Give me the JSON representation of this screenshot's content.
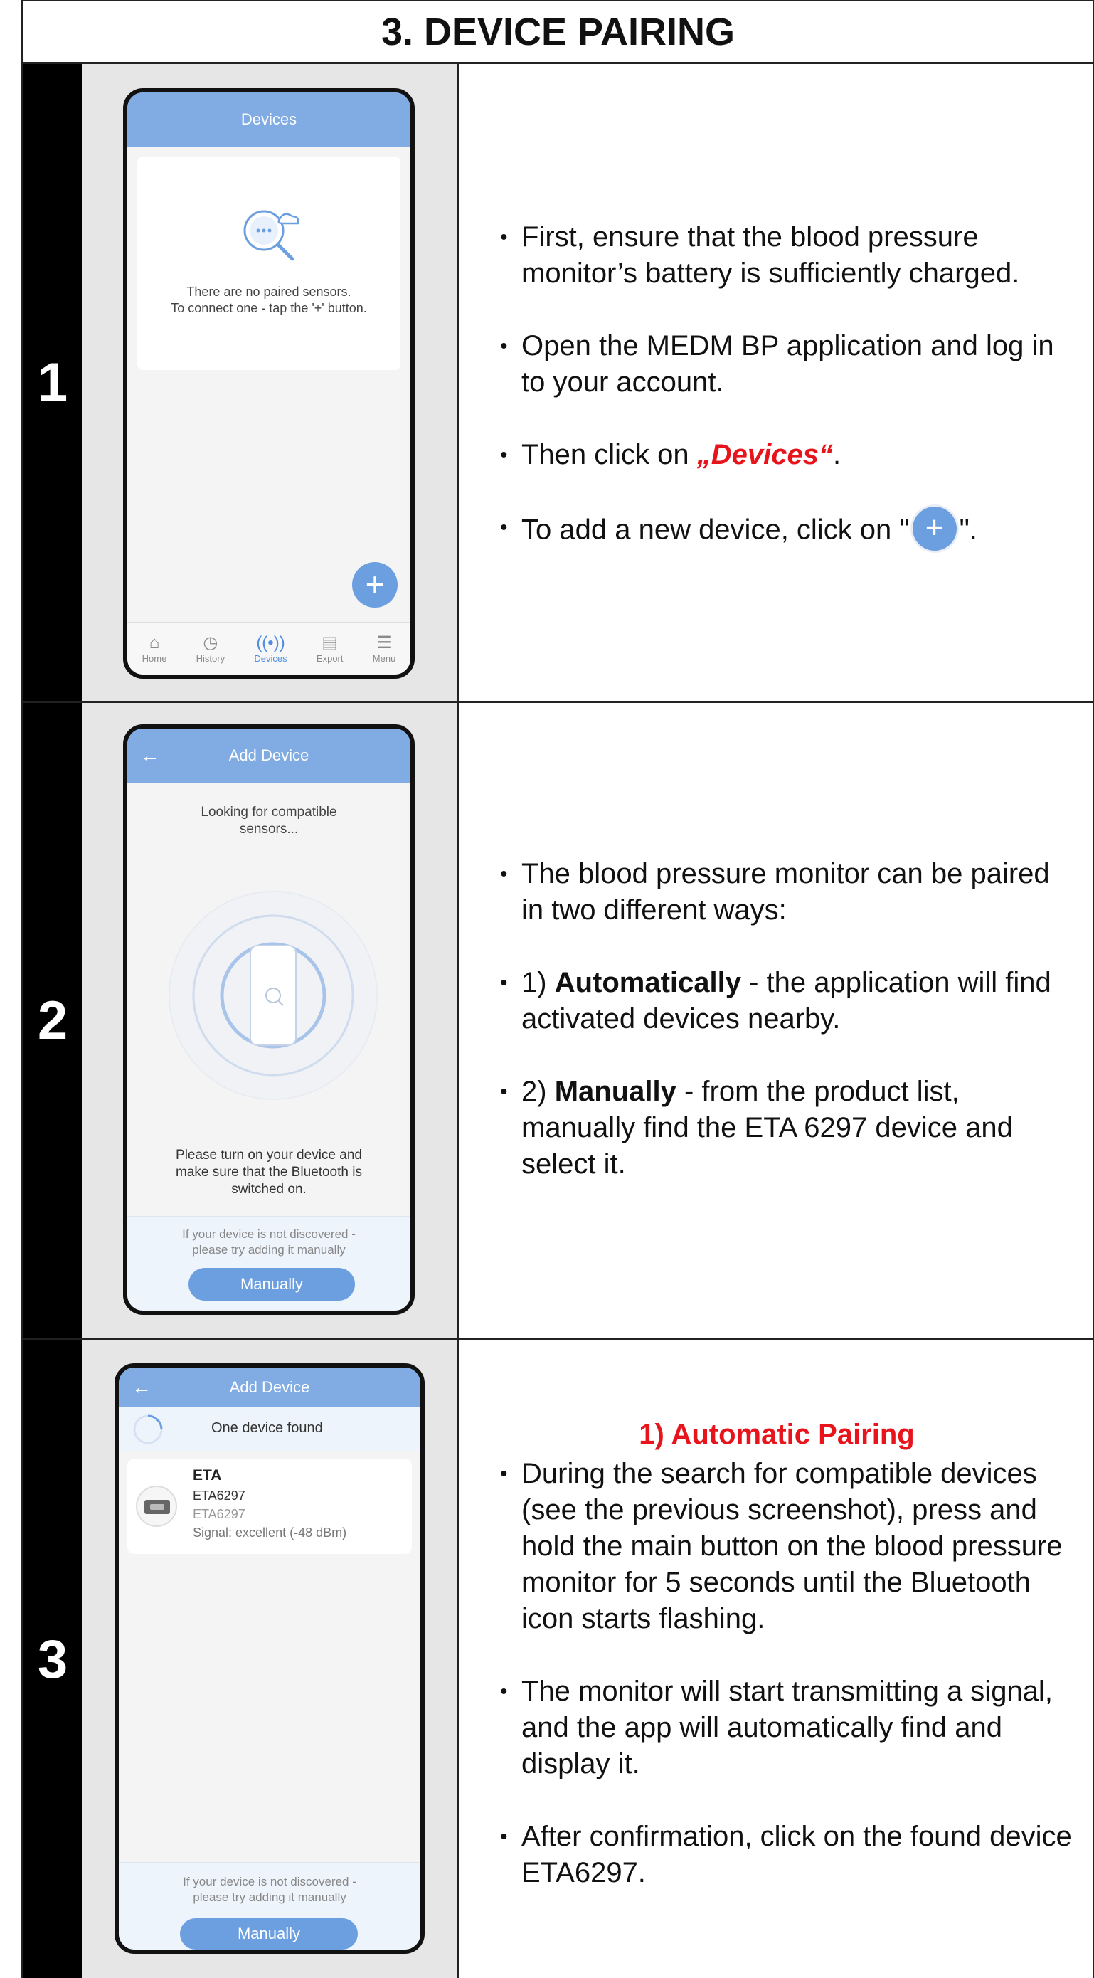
{
  "title": "3. DEVICE PAIRING",
  "steps": [
    {
      "number": "1",
      "phone": {
        "header": "Devices",
        "empty_line1": "There are no paired sensors.",
        "empty_line2": "To connect one - tap the '+' button.",
        "fab": "+",
        "nav": [
          {
            "label": "Home",
            "icon": "home-icon"
          },
          {
            "label": "History",
            "icon": "history-icon"
          },
          {
            "label": "Devices",
            "icon": "devices-icon"
          },
          {
            "label": "Export",
            "icon": "export-icon"
          },
          {
            "label": "Menu",
            "icon": "menu-icon"
          }
        ]
      },
      "bullets": {
        "b1": "First, ensure that the blood pressure monitor’s battery is sufficiently charged.",
        "b2": "Open the MEDM BP application and log in to your account.",
        "b3_pre": "Then click on ",
        "b3_em": "„Devices“",
        "b3_post": ".",
        "b4_pre": "To add a new device, click on \"",
        "b4_plus": "+",
        "b4_post": "\"."
      }
    },
    {
      "number": "2",
      "phone": {
        "header": "Add Device",
        "looking": "Looking for compatible sensors...",
        "instruction": "Please turn on your device and make sure that the Bluetooth is switched on.",
        "hint": "If your device is not discovered - please try adding it manually",
        "button": "Manually"
      },
      "bullets": {
        "b1": "The blood pressure monitor can be paired in two different ways:",
        "b2_pre": "1) ",
        "b2_bold": "Automatically",
        "b2_post": " - the application will find activated devices nearby.",
        "b3_pre": "2) ",
        "b3_bold": "Manually",
        "b3_post": " - from the product list, manually find the ETA 6297 device and select it."
      }
    },
    {
      "number": "3",
      "phone": {
        "header": "Add Device",
        "found": "One device found",
        "device_name": "ETA",
        "device_model": "ETA6297",
        "device_id": "ETA6297",
        "signal": "Signal: excellent (-48 dBm)",
        "hint": "If your device is not discovered - please try adding it manually",
        "button": "Manually"
      },
      "heading": "1) Automatic Pairing",
      "bullets": {
        "b1": "During the search for compatible devices (see the previous screenshot), press and hold the main button on the blood pressure monitor for 5 seconds until the Bluetooth icon starts flashing.",
        "b2": "The monitor will start transmitting a signal, and the app will automatically find and display it.",
        "b3": "After confirmation, click on the found device ETA6297."
      }
    }
  ]
}
